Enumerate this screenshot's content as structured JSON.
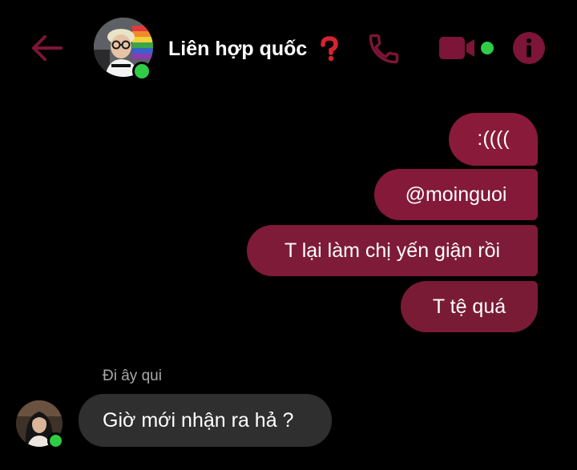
{
  "header": {
    "title": "Liên hợp quốc",
    "title_emoji_icon": "red-question-mark-icon",
    "back_icon": "arrow-left-icon",
    "call_icon": "phone-icon",
    "video_icon": "video-camera-icon",
    "info_icon": "info-icon",
    "contact_online": true
  },
  "messages": {
    "outgoing": [
      {
        "text": ":(((("
      },
      {
        "text": "@moinguoi"
      },
      {
        "text": "T lại làm chị yến giận rồi"
      },
      {
        "text": "T tệ quá"
      }
    ],
    "incoming": {
      "sender": "Đi ây qui",
      "text": "Giờ mới nhận ra hả ?",
      "sender_online": true
    }
  },
  "colors": {
    "accent": "#8a1a3a",
    "icon": "#7c1538",
    "background": "#000000",
    "incoming_bubble": "#2f2f2f",
    "online": "#31cc46"
  }
}
